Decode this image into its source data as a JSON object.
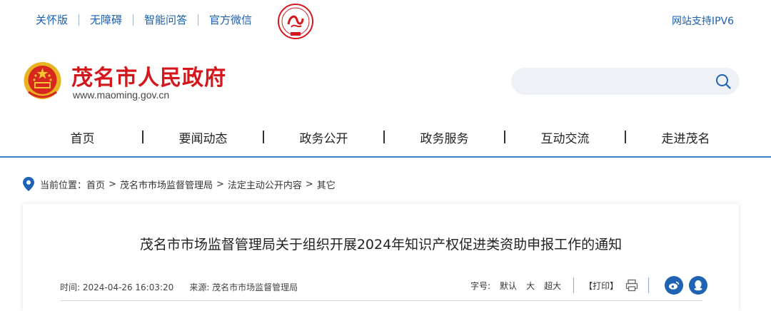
{
  "top": {
    "links": [
      "关怀版",
      "无障碍",
      "智能问答",
      "官方微信"
    ],
    "ipv6": "网站支持IPV6"
  },
  "header": {
    "site_name": "茂名市人民政府",
    "site_url": "www.maoming.gov.cn"
  },
  "search": {
    "placeholder": ""
  },
  "nav": [
    "首页",
    "要闻动态",
    "政务公开",
    "政务服务",
    "互动交流",
    "走进茂名"
  ],
  "breadcrumb": {
    "label": "当前位置：",
    "items": [
      "首页",
      "茂名市市场监督管理局",
      "法定主动公开内容",
      "其它"
    ]
  },
  "article": {
    "title": "茂名市市场监督管理局关于组织开展2024年知识产权促进类资助申报工作的通知",
    "time": "时间: 2024-04-26 16:03:20",
    "source": "来源: 茂名市市场监督管理局",
    "font_label": "字号:",
    "font_default": "默认",
    "font_large": "大",
    "font_xlarge": "超大",
    "print": "【打印】"
  },
  "colors": {
    "brand_red": "#d4171c",
    "link_blue": "#1a5fb0",
    "share_blue": "#1f63b4",
    "nav_line": "#3a80c8"
  }
}
